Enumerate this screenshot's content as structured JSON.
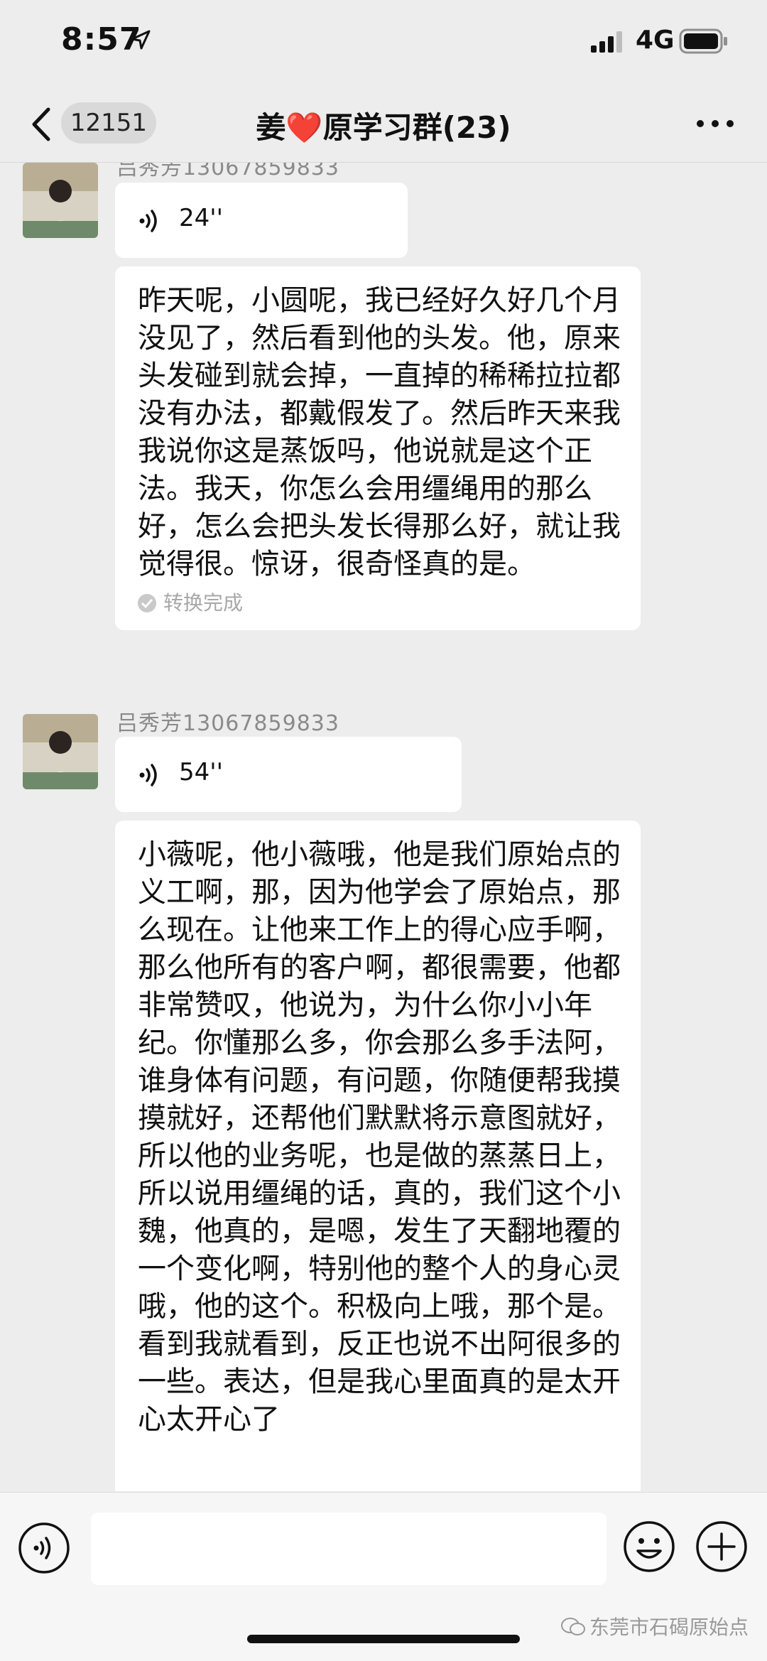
{
  "status_bar": {
    "time": "8:57",
    "network": "4G"
  },
  "nav": {
    "unread_count": "12151",
    "title": "姜❤️原学习群(23)"
  },
  "messages": [
    {
      "sender": "吕秀芳13067859833",
      "voice_duration": "24''",
      "transcript": "昨天呢，小圆呢，我已经好久好几个月没见了，然后看到他的头发。他，原来头发碰到就会掉，一直掉的稀稀拉拉都没有办法，都戴假发了。然后昨天来我我说你这是蒸饭吗，他说就是这个正法。我天，你怎么会用缰绳用的那么好，怎么会把头发长得那么好，就让我觉得很。惊讶，很奇怪真的是。",
      "conversion_status": "转换完成"
    },
    {
      "sender": "吕秀芳13067859833",
      "voice_duration": "54''",
      "transcript": "小薇呢，他小薇哦，他是我们原始点的义工啊，那，因为他学会了原始点，那么现在。让他来工作上的得心应手啊，那么他所有的客户啊，都很需要，他都非常赞叹，他说为，为什么你小小年纪。你懂那么多，你会那么多手法阿，谁身体有问题，有问题，你随便帮我摸摸就好，还帮他们默默将示意图就好，所以他的业务呢，也是做的蒸蒸日上，所以说用缰绳的话，真的，我们这个小魏，他真的，是嗯，发生了天翻地覆的一个变化啊，特别他的整个人的身心灵哦，他的这个。积极向上哦，那个是。看到我就看到，反正也说不出阿很多的一些。表达，但是我心里面真的是太开心太开心了"
    }
  ],
  "watermark": "东莞市石碣原始点",
  "icons": {
    "back": "chevron-left-icon",
    "more": "more-dots-icon",
    "voice": "voice-wave-icon",
    "emoji": "emoji-icon",
    "plus": "plus-icon"
  },
  "colors": {
    "background": "#ededed",
    "bubble": "#ffffff",
    "heart": "#e8262d"
  }
}
